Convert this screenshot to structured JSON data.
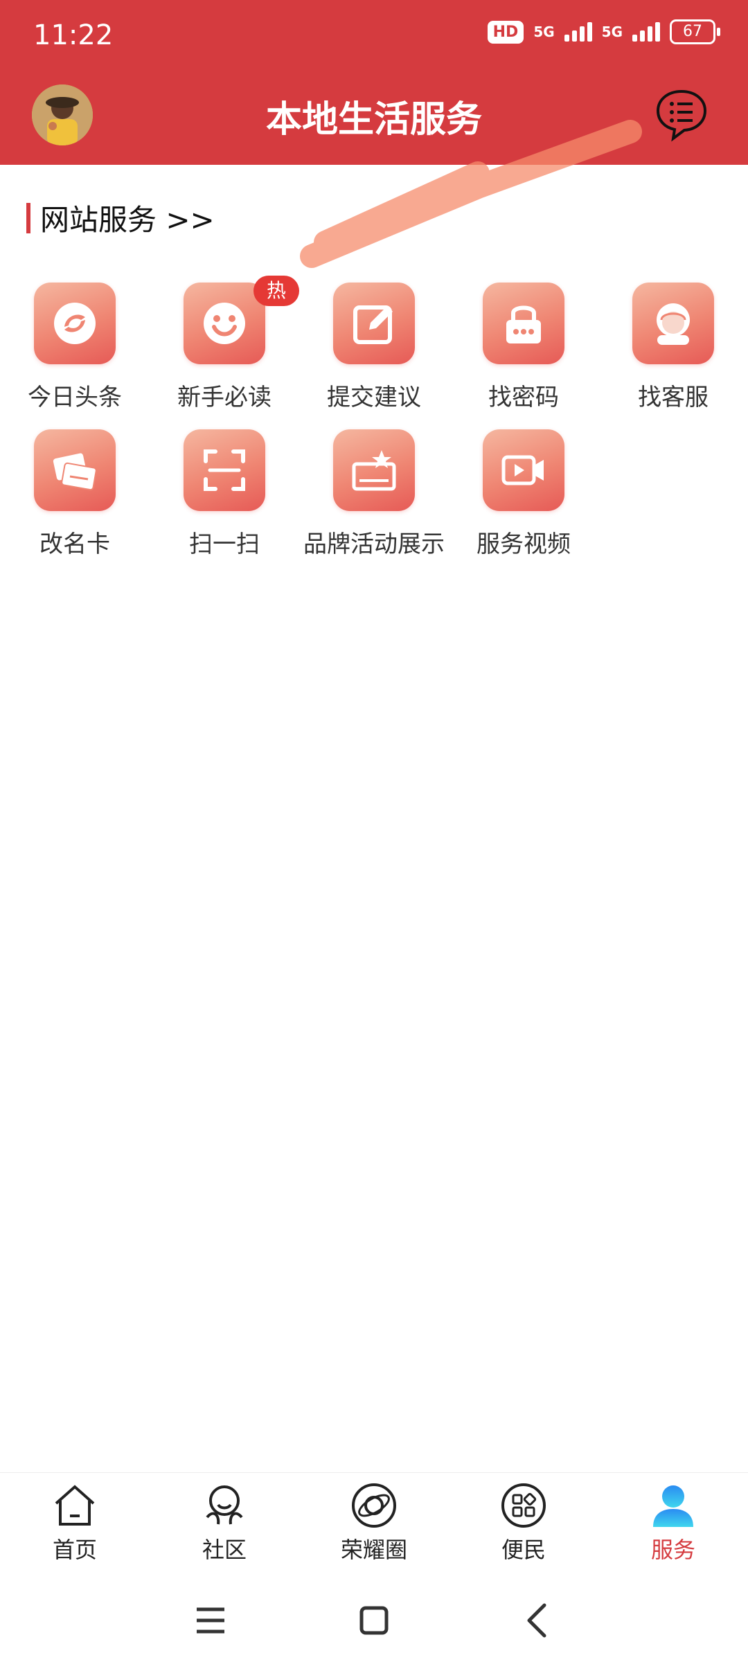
{
  "status_bar": {
    "time": "11:22",
    "hd": "HD",
    "network1": "5G",
    "network2": "5G",
    "battery": "67"
  },
  "header": {
    "title": "本地生活服务"
  },
  "section": {
    "title": "网站服务 >>"
  },
  "services": [
    {
      "label": "今日头条",
      "icon": "refresh-swirl-icon"
    },
    {
      "label": "新手必读",
      "icon": "smiley-icon",
      "badge": "热"
    },
    {
      "label": "提交建议",
      "icon": "edit-icon"
    },
    {
      "label": "找密码",
      "icon": "lock-icon"
    },
    {
      "label": "找客服",
      "icon": "customer-service-icon"
    },
    {
      "label": "改名卡",
      "icon": "id-card-icon"
    },
    {
      "label": "扫一扫",
      "icon": "scan-icon"
    },
    {
      "label": "品牌活动展示",
      "icon": "brand-activity-icon"
    },
    {
      "label": "服务视频",
      "icon": "video-icon"
    }
  ],
  "bottom_nav": [
    {
      "label": "首页",
      "icon": "home-icon"
    },
    {
      "label": "社区",
      "icon": "community-icon"
    },
    {
      "label": "荣耀圈",
      "icon": "honor-circle-icon"
    },
    {
      "label": "便民",
      "icon": "convenience-icon"
    },
    {
      "label": "服务",
      "icon": "service-icon",
      "active": true
    }
  ],
  "colors": {
    "primary": "#d53b3f",
    "tile_start": "#f5b7a0",
    "tile_end": "#e65a56",
    "hot_badge": "#e53935"
  }
}
